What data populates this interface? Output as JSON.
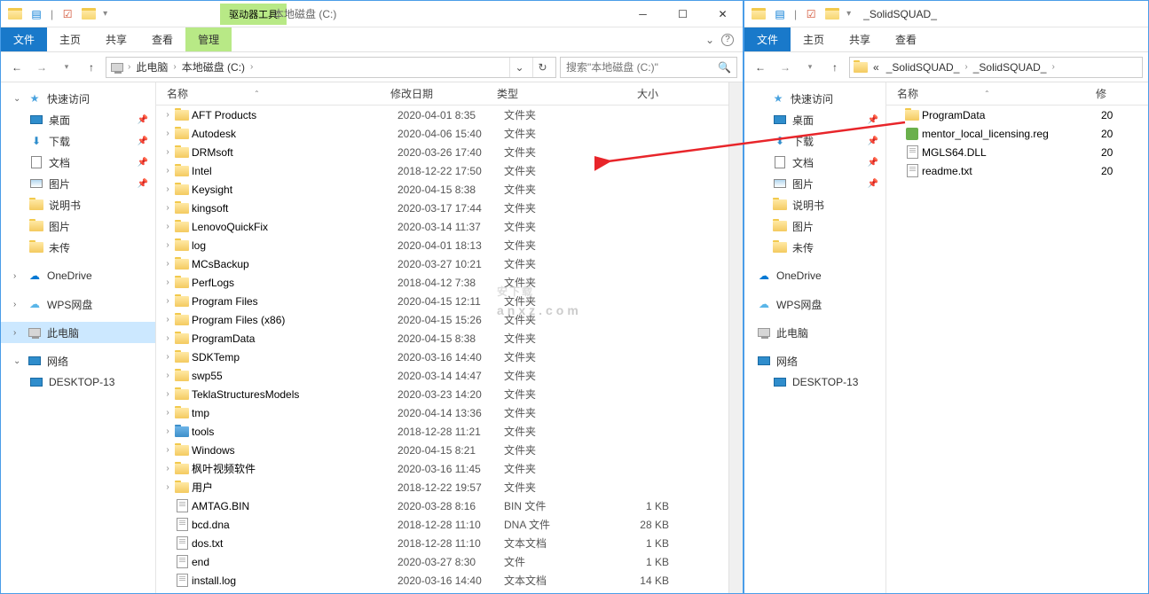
{
  "left": {
    "titlebar_path": "本地磁盘 (C:)",
    "context_tab": "驱动器工具",
    "ribbon": {
      "file": "文件",
      "home": "主页",
      "share": "共享",
      "view": "查看",
      "manage": "管理"
    },
    "breadcrumbs": [
      "此电脑",
      "本地磁盘 (C:)"
    ],
    "search_placeholder": "搜索\"本地磁盘 (C:)\"",
    "columns": {
      "name": "名称",
      "date": "修改日期",
      "type": "类型",
      "size": "大小"
    },
    "sidebar": {
      "quick": "快速访问",
      "items": [
        {
          "label": "桌面",
          "pin": true
        },
        {
          "label": "下载",
          "pin": true
        },
        {
          "label": "文档",
          "pin": true
        },
        {
          "label": "图片",
          "pin": true
        },
        {
          "label": "说明书",
          "pin": false
        },
        {
          "label": "图片",
          "pin": false
        },
        {
          "label": "未传",
          "pin": false
        }
      ],
      "onedrive": "OneDrive",
      "wps": "WPS网盘",
      "thispc": "此电脑",
      "network": "网络",
      "desktop_pc": "DESKTOP-13"
    },
    "files": [
      {
        "name": "AFT Products",
        "date": "2020-04-01 8:35",
        "type": "文件夹",
        "size": "",
        "icon": "folder",
        "expand": true
      },
      {
        "name": "Autodesk",
        "date": "2020-04-06 15:40",
        "type": "文件夹",
        "size": "",
        "icon": "folder",
        "expand": true
      },
      {
        "name": "DRMsoft",
        "date": "2020-03-26 17:40",
        "type": "文件夹",
        "size": "",
        "icon": "folder",
        "expand": true
      },
      {
        "name": "Intel",
        "date": "2018-12-22 17:50",
        "type": "文件夹",
        "size": "",
        "icon": "folder",
        "expand": true
      },
      {
        "name": "Keysight",
        "date": "2020-04-15 8:38",
        "type": "文件夹",
        "size": "",
        "icon": "folder",
        "expand": true
      },
      {
        "name": "kingsoft",
        "date": "2020-03-17 17:44",
        "type": "文件夹",
        "size": "",
        "icon": "folder",
        "expand": true
      },
      {
        "name": "LenovoQuickFix",
        "date": "2020-03-14 11:37",
        "type": "文件夹",
        "size": "",
        "icon": "folder",
        "expand": true
      },
      {
        "name": "log",
        "date": "2020-04-01 18:13",
        "type": "文件夹",
        "size": "",
        "icon": "folder",
        "expand": true
      },
      {
        "name": "MCsBackup",
        "date": "2020-03-27 10:21",
        "type": "文件夹",
        "size": "",
        "icon": "folder",
        "expand": true
      },
      {
        "name": "PerfLogs",
        "date": "2018-04-12 7:38",
        "type": "文件夹",
        "size": "",
        "icon": "folder",
        "expand": true
      },
      {
        "name": "Program Files",
        "date": "2020-04-15 12:11",
        "type": "文件夹",
        "size": "",
        "icon": "folder",
        "expand": true
      },
      {
        "name": "Program Files (x86)",
        "date": "2020-04-15 15:26",
        "type": "文件夹",
        "size": "",
        "icon": "folder",
        "expand": true
      },
      {
        "name": "ProgramData",
        "date": "2020-04-15 8:38",
        "type": "文件夹",
        "size": "",
        "icon": "folder",
        "expand": true
      },
      {
        "name": "SDKTemp",
        "date": "2020-03-16 14:40",
        "type": "文件夹",
        "size": "",
        "icon": "folder",
        "expand": true
      },
      {
        "name": "swp55",
        "date": "2020-03-14 14:47",
        "type": "文件夹",
        "size": "",
        "icon": "folder",
        "expand": true
      },
      {
        "name": "TeklaStructuresModels",
        "date": "2020-03-23 14:20",
        "type": "文件夹",
        "size": "",
        "icon": "folder",
        "expand": true
      },
      {
        "name": "tmp",
        "date": "2020-04-14 13:36",
        "type": "文件夹",
        "size": "",
        "icon": "folder",
        "expand": true
      },
      {
        "name": "tools",
        "date": "2018-12-28 11:21",
        "type": "文件夹",
        "size": "",
        "icon": "bluefolder",
        "expand": true
      },
      {
        "name": "Windows",
        "date": "2020-04-15 8:21",
        "type": "文件夹",
        "size": "",
        "icon": "folder",
        "expand": true
      },
      {
        "name": "枫叶视频软件",
        "date": "2020-03-16 11:45",
        "type": "文件夹",
        "size": "",
        "icon": "folder",
        "expand": true
      },
      {
        "name": "用户",
        "date": "2018-12-22 19:57",
        "type": "文件夹",
        "size": "",
        "icon": "folder",
        "expand": true
      },
      {
        "name": "AMTAG.BIN",
        "date": "2020-03-28 8:16",
        "type": "BIN 文件",
        "size": "1 KB",
        "icon": "file",
        "expand": false
      },
      {
        "name": "bcd.dna",
        "date": "2018-12-28 11:10",
        "type": "DNA 文件",
        "size": "28 KB",
        "icon": "file",
        "expand": false
      },
      {
        "name": "dos.txt",
        "date": "2018-12-28 11:10",
        "type": "文本文档",
        "size": "1 KB",
        "icon": "file",
        "expand": false
      },
      {
        "name": "end",
        "date": "2020-03-27 8:30",
        "type": "文件",
        "size": "1 KB",
        "icon": "file",
        "expand": false
      },
      {
        "name": "install.log",
        "date": "2020-03-16 14:40",
        "type": "文本文档",
        "size": "14 KB",
        "icon": "file",
        "expand": false
      }
    ]
  },
  "right": {
    "title": "_SolidSQUAD_",
    "ribbon": {
      "file": "文件",
      "home": "主页",
      "share": "共享",
      "view": "查看"
    },
    "breadcrumbs": [
      "«",
      "_SolidSQUAD_",
      "_SolidSQUAD_"
    ],
    "columns": {
      "name": "名称",
      "date": "修"
    },
    "sidebar": {
      "quick": "快速访问",
      "items": [
        {
          "label": "桌面",
          "pin": true
        },
        {
          "label": "下载",
          "pin": true
        },
        {
          "label": "文档",
          "pin": true
        },
        {
          "label": "图片",
          "pin": true
        },
        {
          "label": "说明书",
          "pin": false
        },
        {
          "label": "图片",
          "pin": false
        },
        {
          "label": "未传",
          "pin": false
        }
      ],
      "onedrive": "OneDrive",
      "wps": "WPS网盘",
      "thispc": "此电脑",
      "network": "网络",
      "desktop_pc": "DESKTOP-13"
    },
    "files": [
      {
        "name": "ProgramData",
        "date": "20",
        "icon": "folder"
      },
      {
        "name": "mentor_local_licensing.reg",
        "date": "20",
        "icon": "reg"
      },
      {
        "name": "MGLS64.DLL",
        "date": "20",
        "icon": "file"
      },
      {
        "name": "readme.txt",
        "date": "20",
        "icon": "file"
      }
    ]
  },
  "watermark": {
    "main": "安下载",
    "sub": "anxz.com"
  }
}
